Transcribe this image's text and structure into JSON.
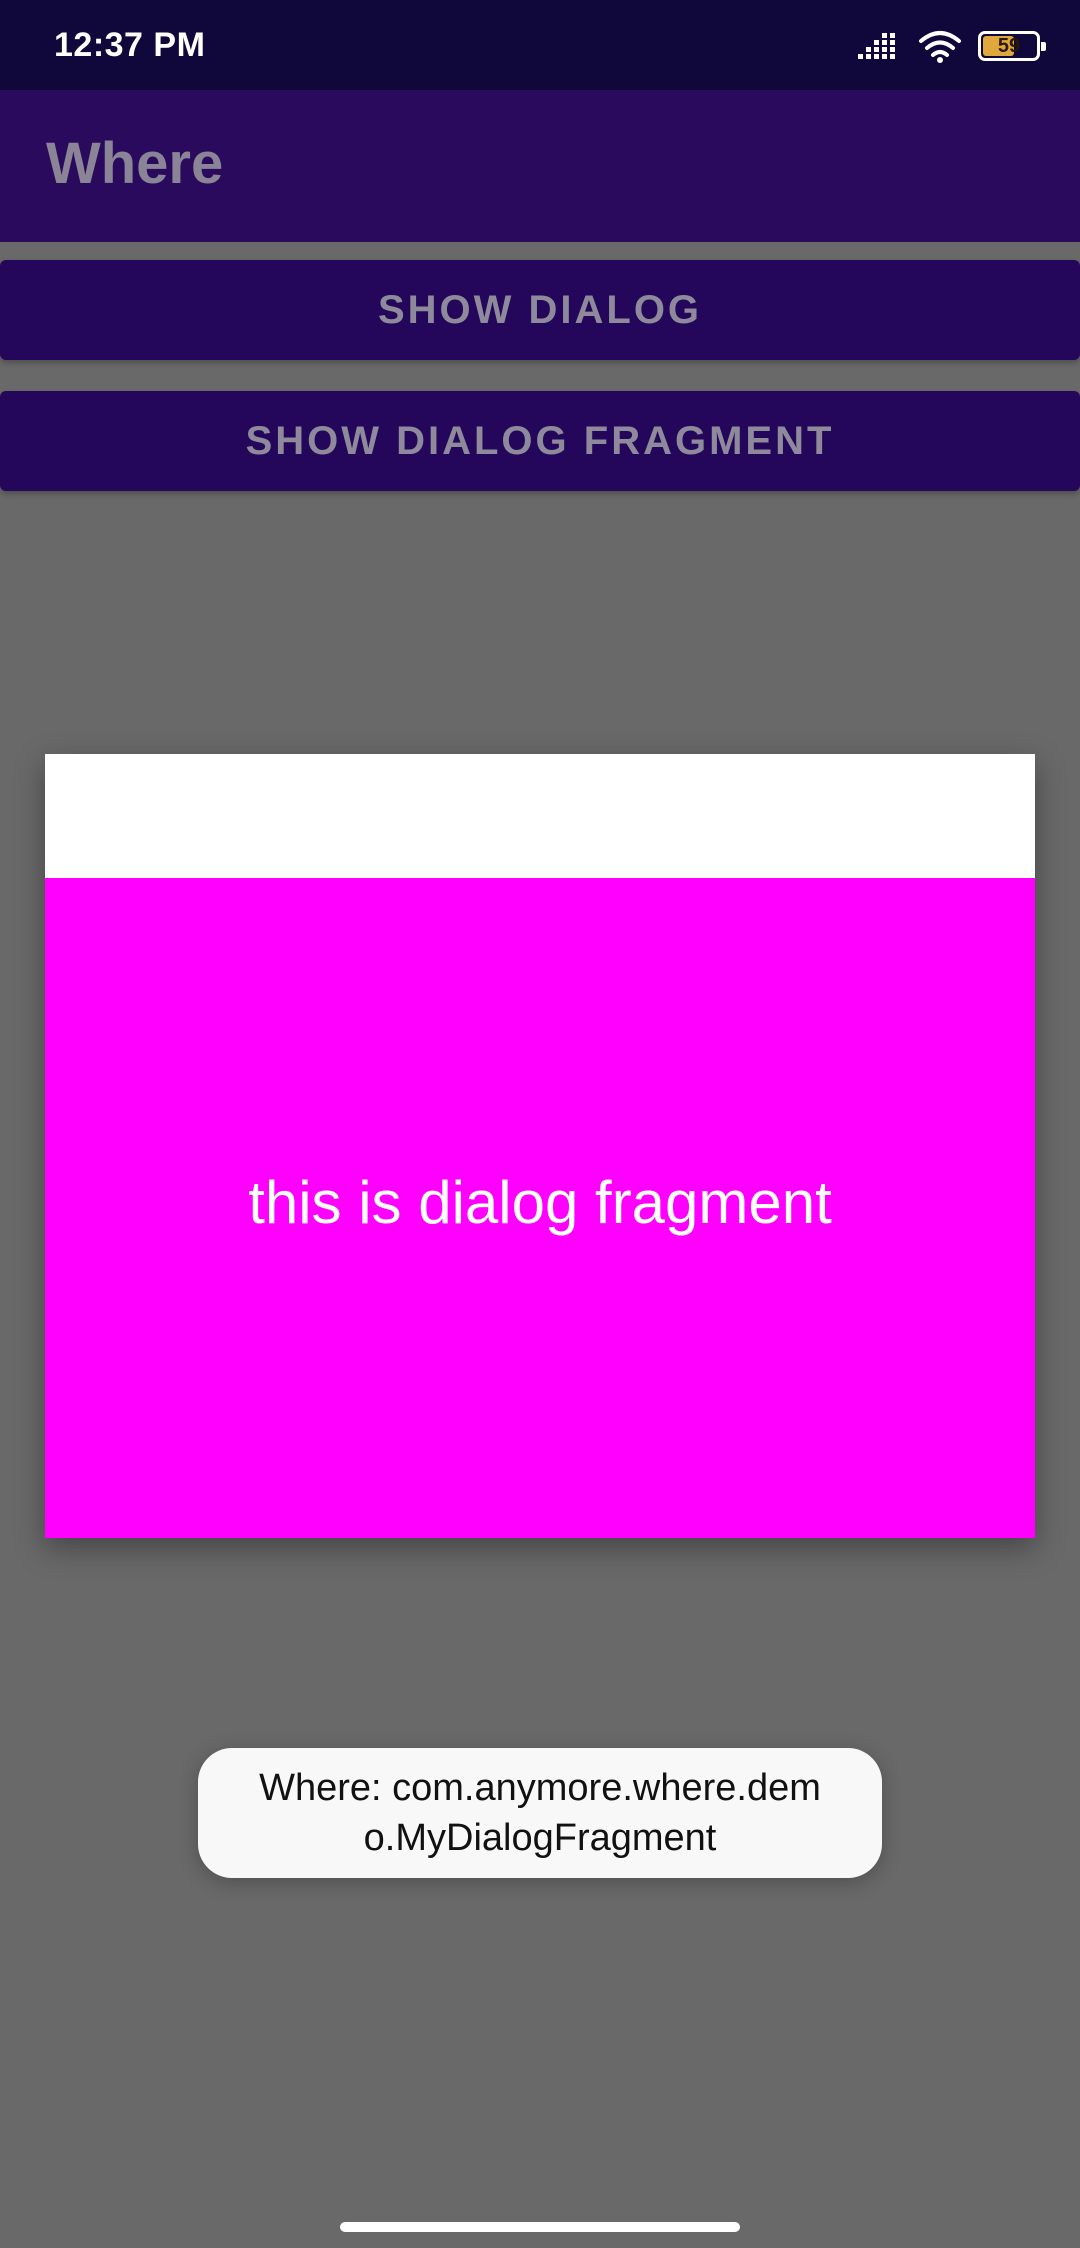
{
  "status_bar": {
    "time": "12:37 PM",
    "battery_level": "59",
    "icons": [
      "signal-icon",
      "wifi-icon",
      "battery-icon"
    ]
  },
  "app_bar": {
    "title": "Where"
  },
  "buttons": {
    "show_dialog": "SHOW DIALOG",
    "show_dialog_fragment": "SHOW DIALOG FRAGMENT"
  },
  "dialog": {
    "title": "",
    "content_text": "this is dialog fragment",
    "content_color": "#ff00ff"
  },
  "toast": {
    "text": "Where: com.anymore.where.demo.MyDialogFragment"
  },
  "colors": {
    "status_bar": "#10083a",
    "primary": "#2a0a5c",
    "scrim": "#696969",
    "accent_fill": "#ff00ff"
  }
}
